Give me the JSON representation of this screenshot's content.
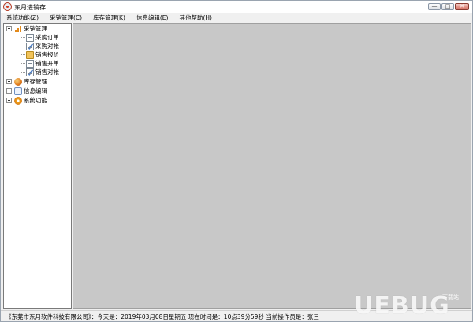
{
  "window": {
    "title": "东月进销存",
    "controls": {
      "minimize": "—",
      "maximize": "□",
      "close": "✕"
    }
  },
  "menu": [
    {
      "id": "system",
      "label": "系统功能(Z)"
    },
    {
      "id": "purchase",
      "label": "采销管理(C)"
    },
    {
      "id": "stock",
      "label": "库存管理(K)"
    },
    {
      "id": "info",
      "label": "信息编辑(E)"
    },
    {
      "id": "help",
      "label": "其他帮助(H)"
    }
  ],
  "tree": {
    "nodes": [
      {
        "label": "采销管理",
        "icon": "bar-chart-icon",
        "expanded": true,
        "children": [
          {
            "label": "采购订单",
            "icon": "document-icon"
          },
          {
            "label": "采购对帐",
            "icon": "edit-document-icon"
          },
          {
            "label": "销售报价",
            "icon": "price-tag-icon"
          },
          {
            "label": "销售开单",
            "icon": "document-icon"
          },
          {
            "label": "销售对帐",
            "icon": "edit-document-icon"
          }
        ]
      },
      {
        "label": "库存管理",
        "icon": "stock-ball-icon",
        "expanded": false
      },
      {
        "label": "信息编辑",
        "icon": "message-icon",
        "expanded": false
      },
      {
        "label": "系统功能",
        "icon": "gear-icon",
        "expanded": false
      }
    ]
  },
  "status": {
    "text": "《东莞市东月软件科技有限公司》：今天是：2019年03月08日星期五   现在时间是：10点39分59秒   当前操作员是：张三"
  },
  "watermark": {
    "main": "UEBUG",
    "sub": "下载站"
  }
}
